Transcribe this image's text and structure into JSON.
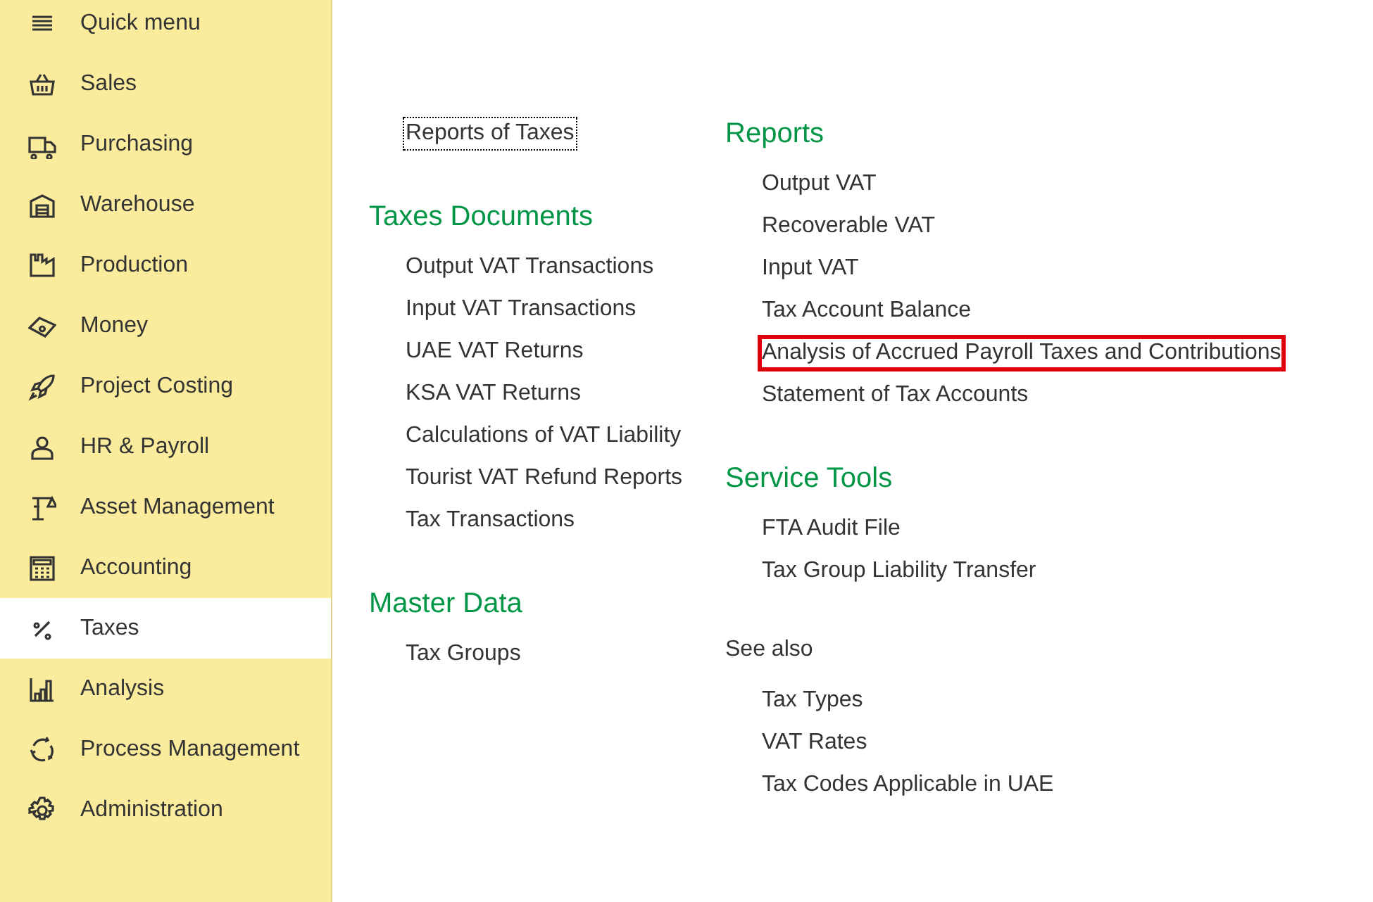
{
  "sidebar": {
    "items": [
      {
        "label": "Quick menu",
        "selected": false
      },
      {
        "label": "Sales",
        "selected": false
      },
      {
        "label": "Purchasing",
        "selected": false
      },
      {
        "label": "Warehouse",
        "selected": false
      },
      {
        "label": "Production",
        "selected": false
      },
      {
        "label": "Money",
        "selected": false
      },
      {
        "label": "Project Costing",
        "selected": false
      },
      {
        "label": "HR & Payroll",
        "selected": false
      },
      {
        "label": "Asset Management",
        "selected": false
      },
      {
        "label": "Accounting",
        "selected": false
      },
      {
        "label": "Taxes",
        "selected": true
      },
      {
        "label": "Analysis",
        "selected": false
      },
      {
        "label": "Process Management",
        "selected": false
      },
      {
        "label": "Administration",
        "selected": false
      }
    ]
  },
  "left_column": {
    "top_link": {
      "label": "Reports of Taxes",
      "focused": true
    },
    "sections": [
      {
        "title": "Taxes Documents",
        "items": [
          {
            "label": "Output VAT Transactions"
          },
          {
            "label": "Input VAT Transactions"
          },
          {
            "label": "UAE VAT Returns"
          },
          {
            "label": "KSA VAT Returns"
          },
          {
            "label": "Calculations of VAT Liability"
          },
          {
            "label": "Tourist VAT Refund Reports"
          },
          {
            "label": "Tax Transactions"
          }
        ]
      },
      {
        "title": "Master Data",
        "items": [
          {
            "label": "Tax Groups"
          }
        ]
      }
    ]
  },
  "right_column": {
    "sections": [
      {
        "title": "Reports",
        "kind": "heading",
        "items": [
          {
            "label": "Output VAT",
            "highlighted": false
          },
          {
            "label": "Recoverable VAT",
            "highlighted": false
          },
          {
            "label": "Input VAT",
            "highlighted": false
          },
          {
            "label": "Tax Account Balance",
            "highlighted": false
          },
          {
            "label": "Analysis of Accrued Payroll Taxes and Contributions",
            "highlighted": true
          },
          {
            "label": "Statement of Tax Accounts",
            "highlighted": false
          }
        ]
      },
      {
        "title": "Service Tools",
        "kind": "heading",
        "items": [
          {
            "label": "FTA Audit File",
            "highlighted": false
          },
          {
            "label": "Tax Group Liability Transfer",
            "highlighted": false
          }
        ]
      },
      {
        "title": "See also",
        "kind": "plain",
        "items": [
          {
            "label": "Tax Types",
            "highlighted": false
          },
          {
            "label": "VAT Rates",
            "highlighted": false
          },
          {
            "label": "Tax Codes Applicable in UAE",
            "highlighted": false
          }
        ]
      }
    ]
  }
}
